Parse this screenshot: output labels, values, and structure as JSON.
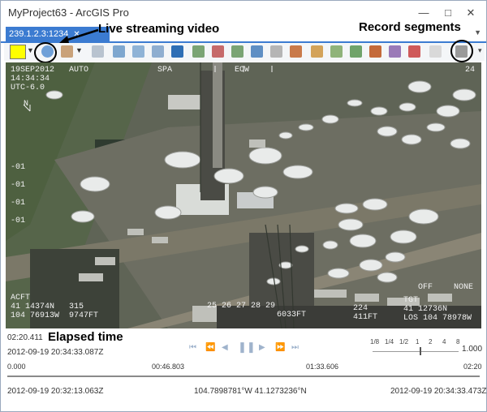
{
  "window": {
    "title": "MyProject63 - ArcGIS Pro",
    "minimize": "—",
    "maximize": "□",
    "close": "✕"
  },
  "tab": {
    "label": "239.1.2.3:1234",
    "pin": "✕"
  },
  "annotations": {
    "live_streaming": "Live streaming video",
    "record_segments": "Record segments",
    "elapsed_time": "Elapsed time"
  },
  "toolbar": {
    "color": "#ffff00",
    "icons": [
      "live-stream-icon",
      "frame-icon",
      "zoom-to-icon",
      "track-icon",
      "rotate-icon",
      "north-icon",
      "capture-icon",
      "clear-icon",
      "export-icon",
      "share-icon",
      "bookmark-icon",
      "snapshot-icon",
      "add-frame-icon",
      "layers-icon",
      "graphic-icon",
      "map-icon",
      "camera-icon",
      "record-icon",
      "more-icon",
      "record-segments-icon"
    ]
  },
  "video": {
    "osd": {
      "top_left": "19SEP2012   AUTO\n14:34:34\nUTC-6.0",
      "top_center": "SPA",
      "top_mid": "EOW",
      "top_right": "24",
      "left_scale": "-01\n\n-01\n\n-01\n\n-01",
      "north": "N",
      "bottom_left": "ACFT\n41 14374N   315\n104 76913W  9747FT",
      "bottom_mid": "25 26 27 28 29",
      "bottom_center": "6033FT",
      "bottom_right_a": "224",
      "bottom_right_b": "411FT",
      "bottom_right_c": "TGT\n41 12736N\nLOS 104 78978W",
      "off": "OFF",
      "none": "NONE"
    }
  },
  "playback": {
    "elapsed": "02:20.411",
    "timestamp": "2012-09-19 20:34:33.087Z",
    "speeds": [
      "1/8",
      "1/4",
      "1/2",
      "1",
      "2",
      "4",
      "8"
    ],
    "speed_value": "1.000",
    "speed_fraction": 0.55,
    "timeline_labels": {
      "start": "0.000",
      "mid1": "00:46.803",
      "mid2": "01:33.606",
      "end": "02:20"
    },
    "progress_fraction": 1.0,
    "start_time": "2012-09-19 20:32:13.063Z",
    "coords": "104.7898781°W 41.1273236°N",
    "end_time": "2012-09-19 20:34:33.473Z"
  }
}
